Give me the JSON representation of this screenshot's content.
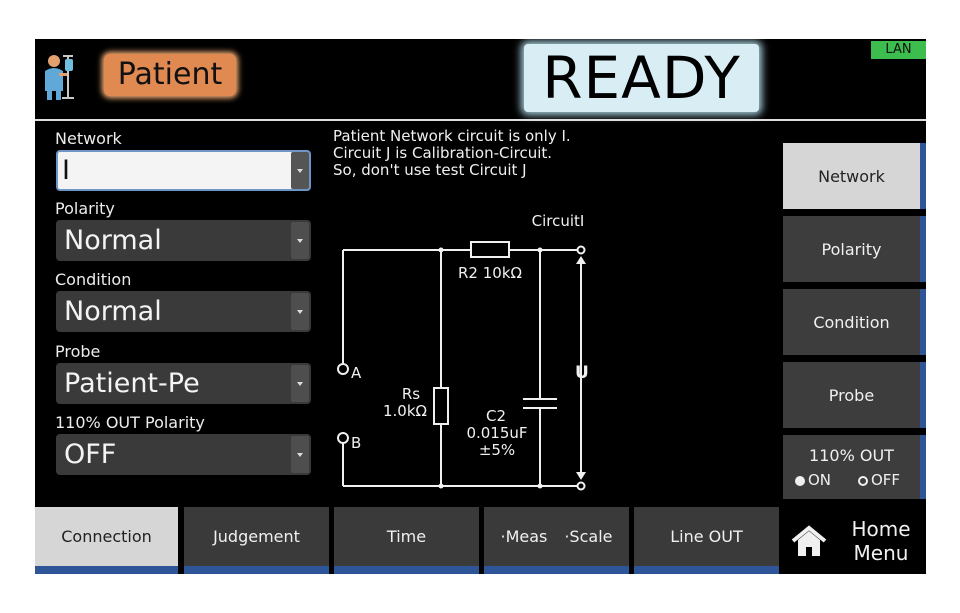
{
  "header": {
    "mode": "Patient",
    "status": "READY",
    "lan": "LAN"
  },
  "settings": [
    {
      "label": "Network",
      "value": "I"
    },
    {
      "label": "Polarity",
      "value": "Normal"
    },
    {
      "label": "Condition",
      "value": "Normal"
    },
    {
      "label": "Probe",
      "value": "Patient-Pe"
    },
    {
      "label": "110% OUT Polarity",
      "value": "OFF"
    }
  ],
  "info": [
    "Patient Network circuit is only I.",
    "Circuit J is Calibration-Circuit.",
    "So, don't use test Circuit J"
  ],
  "circuit": {
    "title": "CircuitI",
    "r2": "R2 10kΩ",
    "rs_name": "Rs",
    "rs_value": "1.0kΩ",
    "c2_name": "C2",
    "c2_value": "0.015uF",
    "c2_tol": "±5%",
    "node_a": "A",
    "node_b": "B",
    "u": "U"
  },
  "side_buttons": [
    {
      "label": "Network",
      "active": true
    },
    {
      "label": "Polarity",
      "active": false
    },
    {
      "label": "Condition",
      "active": false
    },
    {
      "label": "Probe",
      "active": false
    }
  ],
  "out_toggle": {
    "label": "110% OUT",
    "on": "ON",
    "off": "OFF",
    "selected": "ON"
  },
  "tabs": [
    {
      "label": "Connection",
      "active": true
    },
    {
      "label": "Judgement",
      "active": false
    },
    {
      "label": "Time",
      "active": false
    },
    {
      "label": "·Meas",
      "label2": "·Scale",
      "active": false
    },
    {
      "label": "Line OUT",
      "active": false
    }
  ],
  "home": {
    "line1": "Home",
    "line2": "Menu"
  },
  "colors": {
    "screen_bg": "#000000",
    "mode_badge": "#e08a52",
    "status_box": "#d8eef4",
    "lan_badge": "#3dbd4d",
    "accent_blue": "#2d5597",
    "button_gray": "#3a3a3a",
    "active_gray": "#d6d6d6"
  }
}
